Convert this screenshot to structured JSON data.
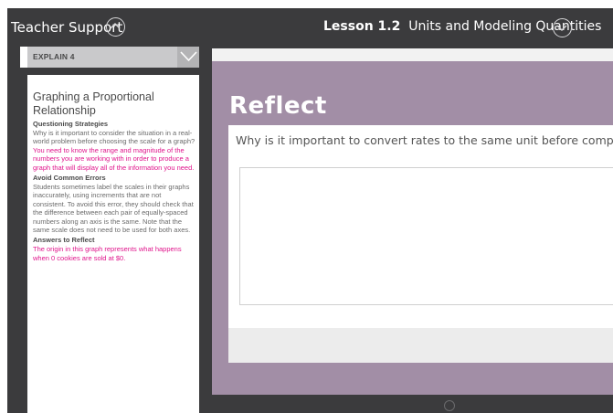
{
  "header": {
    "teacher_support": "Teacher Support",
    "lesson_number": "Lesson 1.2",
    "lesson_title": "Units and Modeling Quantities"
  },
  "sidebar": {
    "section_label": "EXPLAIN 4",
    "title": "Graphing a Proportional Relationship",
    "blocks": [
      {
        "heading": "Questioning Strategies",
        "text_plain": "Why is it important to consider the situation in a real-world problem before choosing the scale for a graph?",
        "text_highlight": "You need to know the range and magnitude of the numbers you are working with in order to produce a graph that will display all of the information you need."
      },
      {
        "heading": "Avoid Common Errors",
        "text_plain": "Students sometimes label the scales in their graphs inaccurately, using increments that are not consistent. To avoid this error, they should check that the difference between each pair of equally-spaced numbers along an axis is the same. Note that the same scale does not need to be used for both axes."
      },
      {
        "heading": "Answers to Reflect",
        "text_highlight": "The origin in this graph represents what happens when 0 cookies are sold at $0."
      }
    ]
  },
  "main": {
    "heading": "Reflect",
    "question": "Why is it important to convert rates to the same unit before comparing",
    "answer_value": ""
  },
  "colors": {
    "accent_purple": "#a28ea6",
    "highlight_pink": "#e0158c",
    "chrome_dark": "#3b3b3d"
  },
  "icons": {
    "header_up": "chevron-up-circle-icon",
    "header_down": "chevron-down-circle-icon",
    "sidebar_toggle": "chevron-down-icon",
    "footer": "info-icon"
  }
}
